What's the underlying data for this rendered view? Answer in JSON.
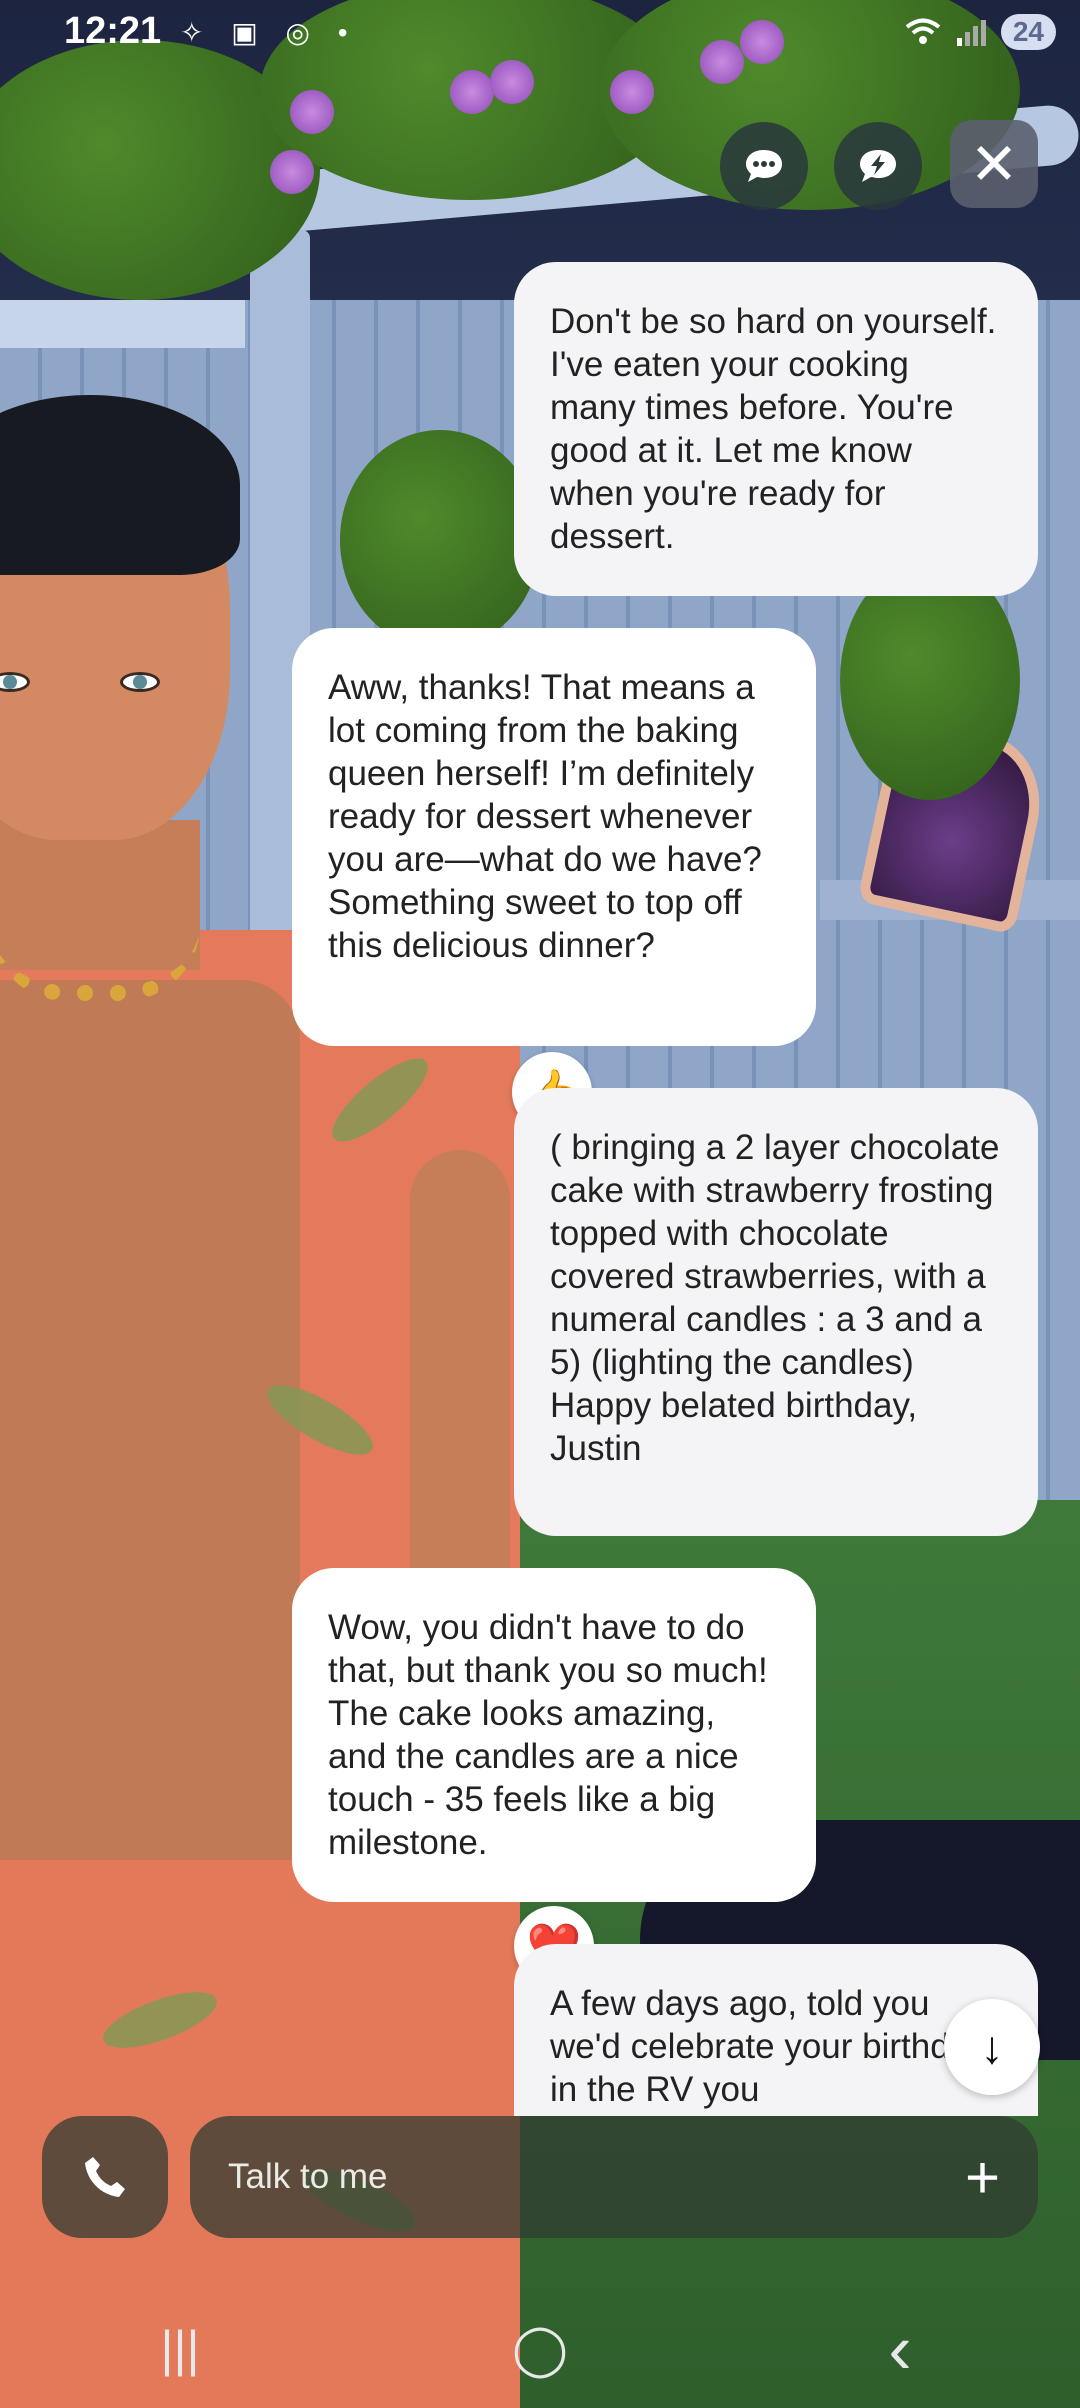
{
  "status_bar": {
    "time": "12:21",
    "left_icons": [
      "sparkle-icon",
      "screenshot-icon",
      "nfc-icon",
      "dot-icon"
    ],
    "right_icons": [
      "wifi-icon",
      "signal-icon"
    ],
    "battery": "24"
  },
  "top_controls": {
    "chat_icon": "speech-bubble-icon",
    "voice_icon": "lightning-bubble-icon",
    "close_icon": "close-icon",
    "close_glyph": "✕"
  },
  "messages": [
    {
      "role": "user",
      "text": "Don't be so hard on yourself. I've eaten your cooking many times before. You're good at it. Let me know when you're ready for dessert."
    },
    {
      "role": "character",
      "text": "Aww, thanks! That means a lot coming from the baking queen herself! I’m definitely ready for dessert whenever you are—what do we have? Something sweet to top off this delicious dinner?",
      "reaction": "👍"
    },
    {
      "role": "user",
      "text": "( bringing a 2 layer chocolate cake with strawberry frosting topped with chocolate covered strawberries, with a numeral candles : a 3 and a 5) (lighting the candles) Happy belated birthday, Justin"
    },
    {
      "role": "character",
      "text": "Wow, you didn't have to do that, but thank you so much! The cake looks amazing, and the candles are a nice touch - 35 feels like a big milestone.",
      "reaction": "❤️"
    },
    {
      "role": "user",
      "text": "A few days ago, told you we'd celebrate your birthday in the RV you"
    }
  ],
  "scroll_down": "↓",
  "input": {
    "placeholder": "Talk to me",
    "add": "+"
  },
  "nav": {
    "recents": "|||",
    "home": "◯",
    "back": "‹"
  },
  "colors": {
    "bubble": "#ffffff",
    "input_bg": "#323c32"
  }
}
